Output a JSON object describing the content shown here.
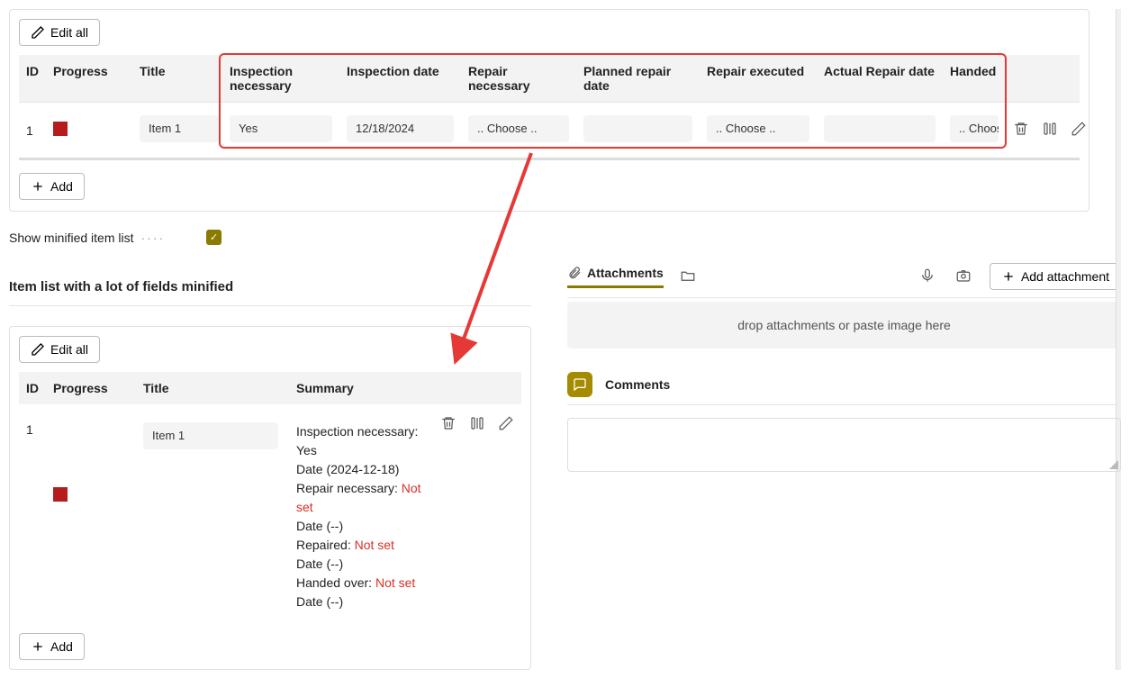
{
  "editAll": "Edit all",
  "addRow": "Add",
  "choosePlaceholder": ".. Choose ..",
  "table1": {
    "headers": {
      "id": "ID",
      "progress": "Progress",
      "title": "Title",
      "insp_nec": "Inspection necessary",
      "insp_date": "Inspection date",
      "rep_nec": "Repair necessary",
      "plan_date": "Planned repair date",
      "rep_exec": "Repair executed",
      "act_date": "Actual Repair date",
      "handed": "Handed"
    },
    "row": {
      "id": "1",
      "title": "Item 1",
      "insp_nec": "Yes",
      "insp_date": "12/18/2024",
      "handed": ".. Choos"
    }
  },
  "toggle": {
    "label": "Show minified item list"
  },
  "miniSectionTitle": "Item list with a lot of fields minified",
  "table2": {
    "headers": {
      "id": "ID",
      "progress": "Progress",
      "title": "Title",
      "summary": "Summary"
    },
    "row": {
      "id": "1",
      "title": "Item 1",
      "summary": {
        "l1a": "Inspection necessary:",
        "l1b": "Yes",
        "l2": "Date (2024-12-18)",
        "l3a": "Repair necessary: ",
        "l3b": "Not set",
        "l4": "Date (--)",
        "l5a": "Repaired: ",
        "l5b": "Not set",
        "l6": "Date (--)",
        "l7a": "Handed over: ",
        "l7b": "Not set",
        "l8": "Date (--)"
      }
    }
  },
  "attachments": {
    "tab": "Attachments",
    "addBtn": "Add attachment",
    "dropText": "drop attachments or paste image here"
  },
  "comments": {
    "title": "Comments"
  }
}
